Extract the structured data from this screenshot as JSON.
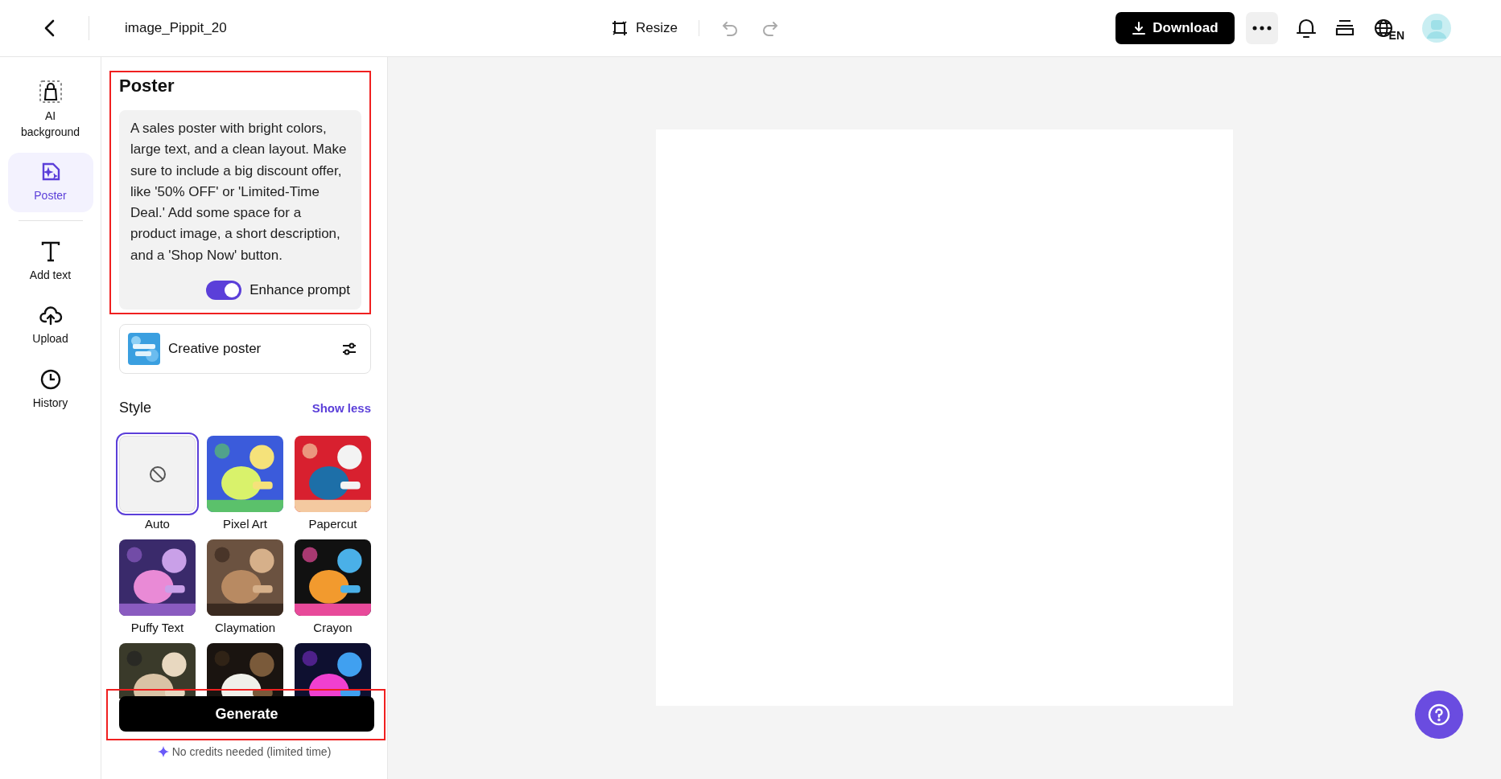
{
  "topbar": {
    "title": "image_Pippit_20",
    "resize": "Resize",
    "download": "Download",
    "language": "EN"
  },
  "sidebar": {
    "items": [
      {
        "label": "AI background",
        "selected": false
      },
      {
        "label": "Poster",
        "selected": true
      },
      {
        "label": "Add text",
        "selected": false
      },
      {
        "label": "Upload",
        "selected": false
      },
      {
        "label": "History",
        "selected": false
      }
    ]
  },
  "panel": {
    "title": "Poster",
    "highlighted": true,
    "prompt": {
      "value": "A sales poster with bright colors, large text, and a clean layout. Make sure to include a big discount offer, like '50% OFF' or 'Limited-Time Deal.' Add some space for a product image, a short description, and a 'Shop Now' button.",
      "enhance_label": "Enhance prompt",
      "enhance_on": true
    },
    "template": {
      "label": "Creative poster"
    },
    "style": {
      "heading": "Style",
      "toggle_link": "Show less",
      "items": [
        {
          "label": "Auto",
          "kind": "none",
          "selected": true
        },
        {
          "label": "Pixel Art",
          "kind": "picture",
          "selected": false
        },
        {
          "label": "Papercut",
          "kind": "picture",
          "selected": false
        },
        {
          "label": "Puffy Text",
          "kind": "picture",
          "selected": false
        },
        {
          "label": "Claymation",
          "kind": "picture",
          "selected": false
        },
        {
          "label": "Crayon",
          "kind": "picture",
          "selected": false
        },
        {
          "kind": "picture",
          "selected": false
        },
        {
          "kind": "picture",
          "selected": false
        },
        {
          "kind": "picture",
          "selected": false
        }
      ]
    },
    "generate": {
      "label": "Generate",
      "highlighted": true,
      "note": "No credits needed (limited time)"
    }
  }
}
